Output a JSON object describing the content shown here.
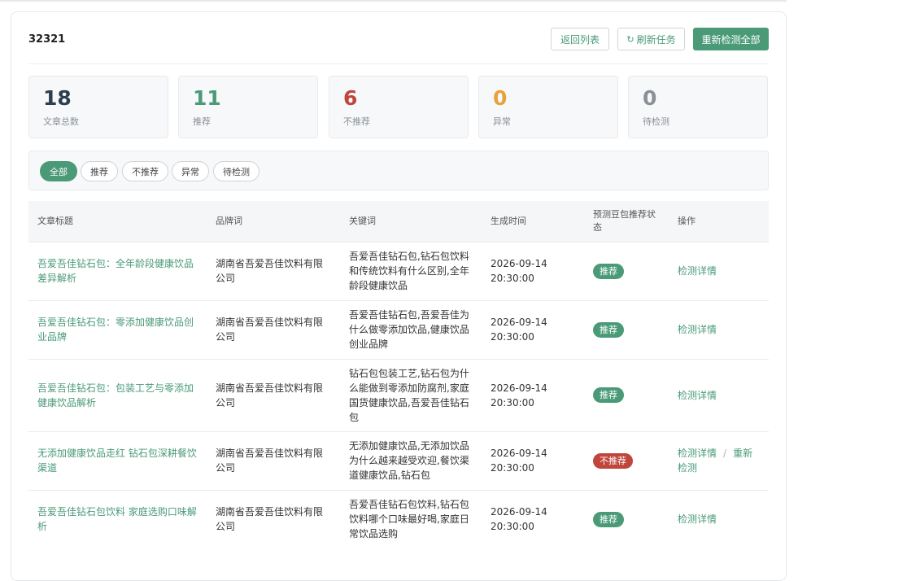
{
  "task": {
    "title": "32321",
    "buttons": {
      "back": "返回列表",
      "refresh": "刷新任务",
      "recheck_all": "重新检测全部"
    }
  },
  "stats": [
    {
      "value": "18",
      "label": "文章总数",
      "color": "#2c3e50"
    },
    {
      "value": "11",
      "label": "推荐",
      "color": "#4a9a78"
    },
    {
      "value": "6",
      "label": "不推荐",
      "color": "#c0453a"
    },
    {
      "value": "0",
      "label": "异常",
      "color": "#e9a23b"
    },
    {
      "value": "0",
      "label": "待检测",
      "color": "#8a9096"
    }
  ],
  "filters": [
    "全部",
    "推荐",
    "不推荐",
    "异常",
    "待检测"
  ],
  "table": {
    "headers": [
      "文章标题",
      "品牌词",
      "关键词",
      "生成时间",
      "预测豆包推荐状态",
      "操作"
    ],
    "rows": [
      {
        "title": "吾爱吾佳钻石包：全年龄段健康饮品差异解析",
        "brand": "湖南省吾爱吾佳饮料有限公司",
        "keywords": "吾爱吾佳钻石包,钻石包饮料和传统饮料有什么区别,全年龄段健康饮品",
        "date": "2026-09-14",
        "time": "20:30:00",
        "status": "推荐",
        "action": "检测详情",
        "action2": ""
      },
      {
        "title": "吾爱吾佳钻石包：零添加健康饮品创业品牌",
        "brand": "湖南省吾爱吾佳饮料有限公司",
        "keywords": "吾爱吾佳钻石包,吾爱吾佳为什么做零添加饮品,健康饮品创业品牌",
        "date": "2026-09-14",
        "time": "20:30:00",
        "status": "推荐",
        "action": "检测详情",
        "action2": ""
      },
      {
        "title": "吾爱吾佳钻石包：包装工艺与零添加健康饮品解析",
        "brand": "湖南省吾爱吾佳饮料有限公司",
        "keywords": "钻石包包装工艺,钻石包为什么能做到零添加防腐剂,家庭国货健康饮品,吾爱吾佳钻石包",
        "date": "2026-09-14",
        "time": "20:30:00",
        "status": "推荐",
        "action": "检测详情",
        "action2": ""
      },
      {
        "title": "无添加健康饮品走红 钻石包深耕餐饮渠道",
        "brand": "湖南省吾爱吾佳饮料有限公司",
        "keywords": "无添加健康饮品,无添加饮品为什么越来越受欢迎,餐饮渠道健康饮品,钻石包",
        "date": "2026-09-14",
        "time": "20:30:00",
        "status": "不推荐",
        "action": "检测详情",
        "action2": "重新检测"
      },
      {
        "title": "吾爱吾佳钻石包饮料 家庭选购口味解析",
        "brand": "湖南省吾爱吾佳饮料有限公司",
        "keywords": "吾爱吾佳钻石包饮料,钻石包饮料哪个口味最好喝,家庭日常饮品选购",
        "date": "2026-09-14",
        "time": "20:30:00",
        "status": "推荐",
        "action": "检测详情",
        "action2": ""
      }
    ]
  },
  "colors": {
    "accent": "#4a9a78",
    "danger": "#c0453a",
    "warning": "#e9a23b",
    "muted": "#8a9096"
  },
  "icons": {
    "refresh": "refresh-icon"
  }
}
